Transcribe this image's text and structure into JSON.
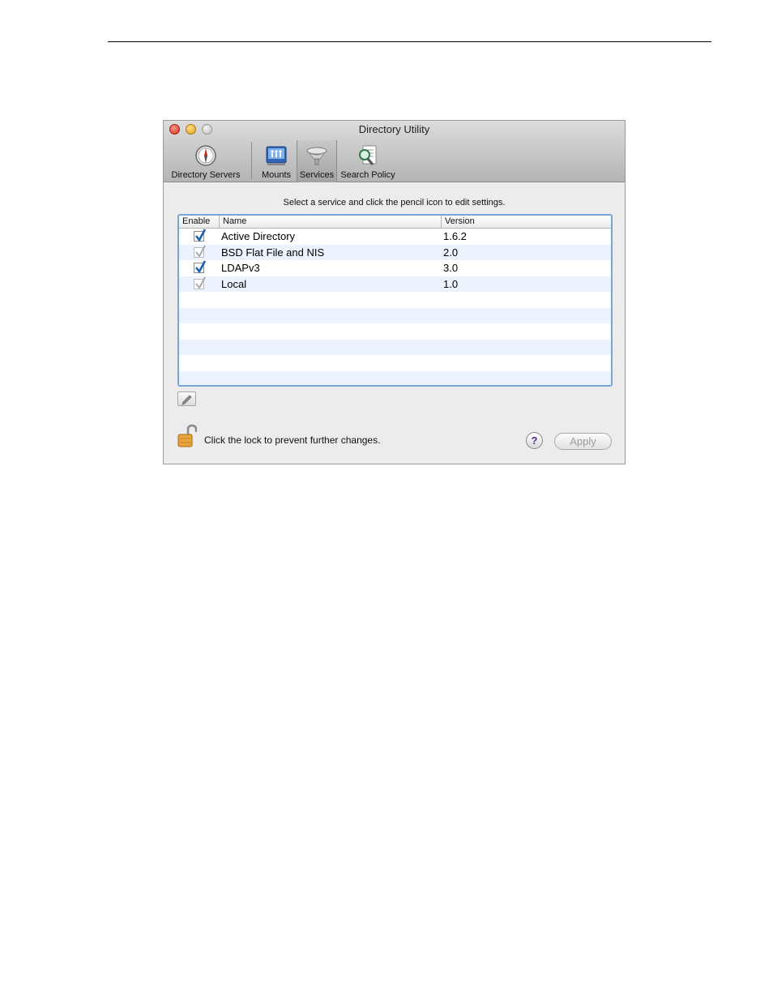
{
  "window": {
    "title": "Directory Utility"
  },
  "toolbar": {
    "items": [
      {
        "label": "Directory Servers",
        "icon": "compass-icon"
      },
      {
        "label": "Mounts",
        "icon": "mounts-icon"
      },
      {
        "label": "Services",
        "icon": "services-icon",
        "selected": true
      },
      {
        "label": "Search Policy",
        "icon": "search-policy-icon"
      }
    ]
  },
  "instruction": "Select a service and click the pencil icon to edit settings.",
  "table": {
    "columns": [
      "Enable",
      "Name",
      "Version"
    ],
    "rows": [
      {
        "name": "Active Directory",
        "version": "1.6.2",
        "enabled": true
      },
      {
        "name": "BSD Flat File and NIS",
        "version": "2.0",
        "enabled": true
      },
      {
        "name": "LDAPv3",
        "version": "3.0",
        "enabled": true
      },
      {
        "name": "Local",
        "version": "1.0",
        "enabled": true
      }
    ]
  },
  "lock": {
    "text": "Click the lock to prevent further changes."
  },
  "buttons": {
    "help": "?",
    "apply": "Apply"
  },
  "colors": {
    "selection_border": "#7aa3d8",
    "alt_row": "#edf3fe",
    "check_active": "#1f5fb0"
  }
}
